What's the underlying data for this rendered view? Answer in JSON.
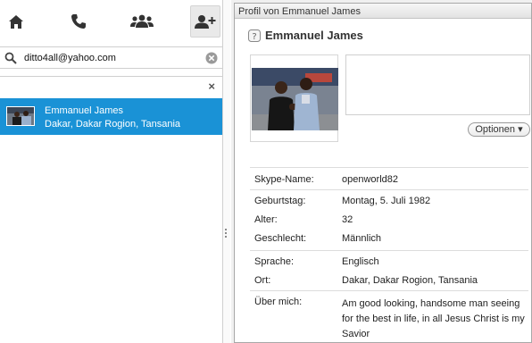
{
  "nav": {
    "icons": [
      "home-icon",
      "phone-icon",
      "group-icon",
      "add-contact-icon"
    ]
  },
  "search": {
    "value": "ditto4all@yahoo.com"
  },
  "results": {
    "close_glyph": "×"
  },
  "contact": {
    "name": "Emmanuel James",
    "location": "Dakar, Dakar Rogion, Tansania"
  },
  "profile_window": {
    "title": "Profil von Emmanuel James",
    "name": "Emmanuel James",
    "options_label": "Optionen ▾",
    "fields": {
      "skype_name": {
        "label": "Skype-Name:",
        "value": "openworld82"
      },
      "birthday": {
        "label": "Geburtstag:",
        "value": "Montag, 5. Juli 1982"
      },
      "age": {
        "label": "Alter:",
        "value": "32"
      },
      "gender": {
        "label": "Geschlecht:",
        "value": "Männlich"
      },
      "language": {
        "label": "Sprache:",
        "value": "Englisch"
      },
      "location": {
        "label": "Ort:",
        "value": "Dakar, Dakar Rogion, Tansania"
      },
      "about": {
        "label": "Über mich:",
        "value": "Am good looking, handsome man seeing for the best in life, in all Jesus Christ is my Savior"
      }
    }
  },
  "colors": {
    "accent": "#1a92d6",
    "icon": "#333333"
  }
}
